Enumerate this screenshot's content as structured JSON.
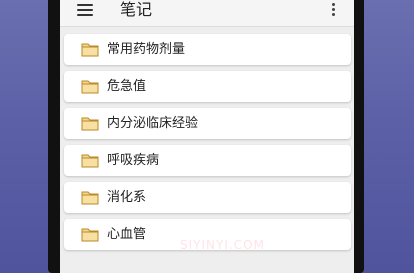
{
  "appbar": {
    "title": "笔记",
    "menu_icon": "hamburger-menu-icon",
    "more_icon": "more-vertical-icon"
  },
  "notes": [
    {
      "label": "常用药物剂量",
      "icon": "folder-icon"
    },
    {
      "label": "危急值",
      "icon": "folder-icon"
    },
    {
      "label": "内分泌临床经验",
      "icon": "folder-icon"
    },
    {
      "label": "呼吸疾病",
      "icon": "folder-icon"
    },
    {
      "label": "消化系",
      "icon": "folder-icon"
    },
    {
      "label": "心血管",
      "icon": "folder-icon"
    }
  ],
  "watermark": "SIYINYI.COM",
  "colors": {
    "background": "#5a5fa6",
    "folder_fill": "#f5d58a",
    "folder_stroke": "#b88a2a"
  }
}
